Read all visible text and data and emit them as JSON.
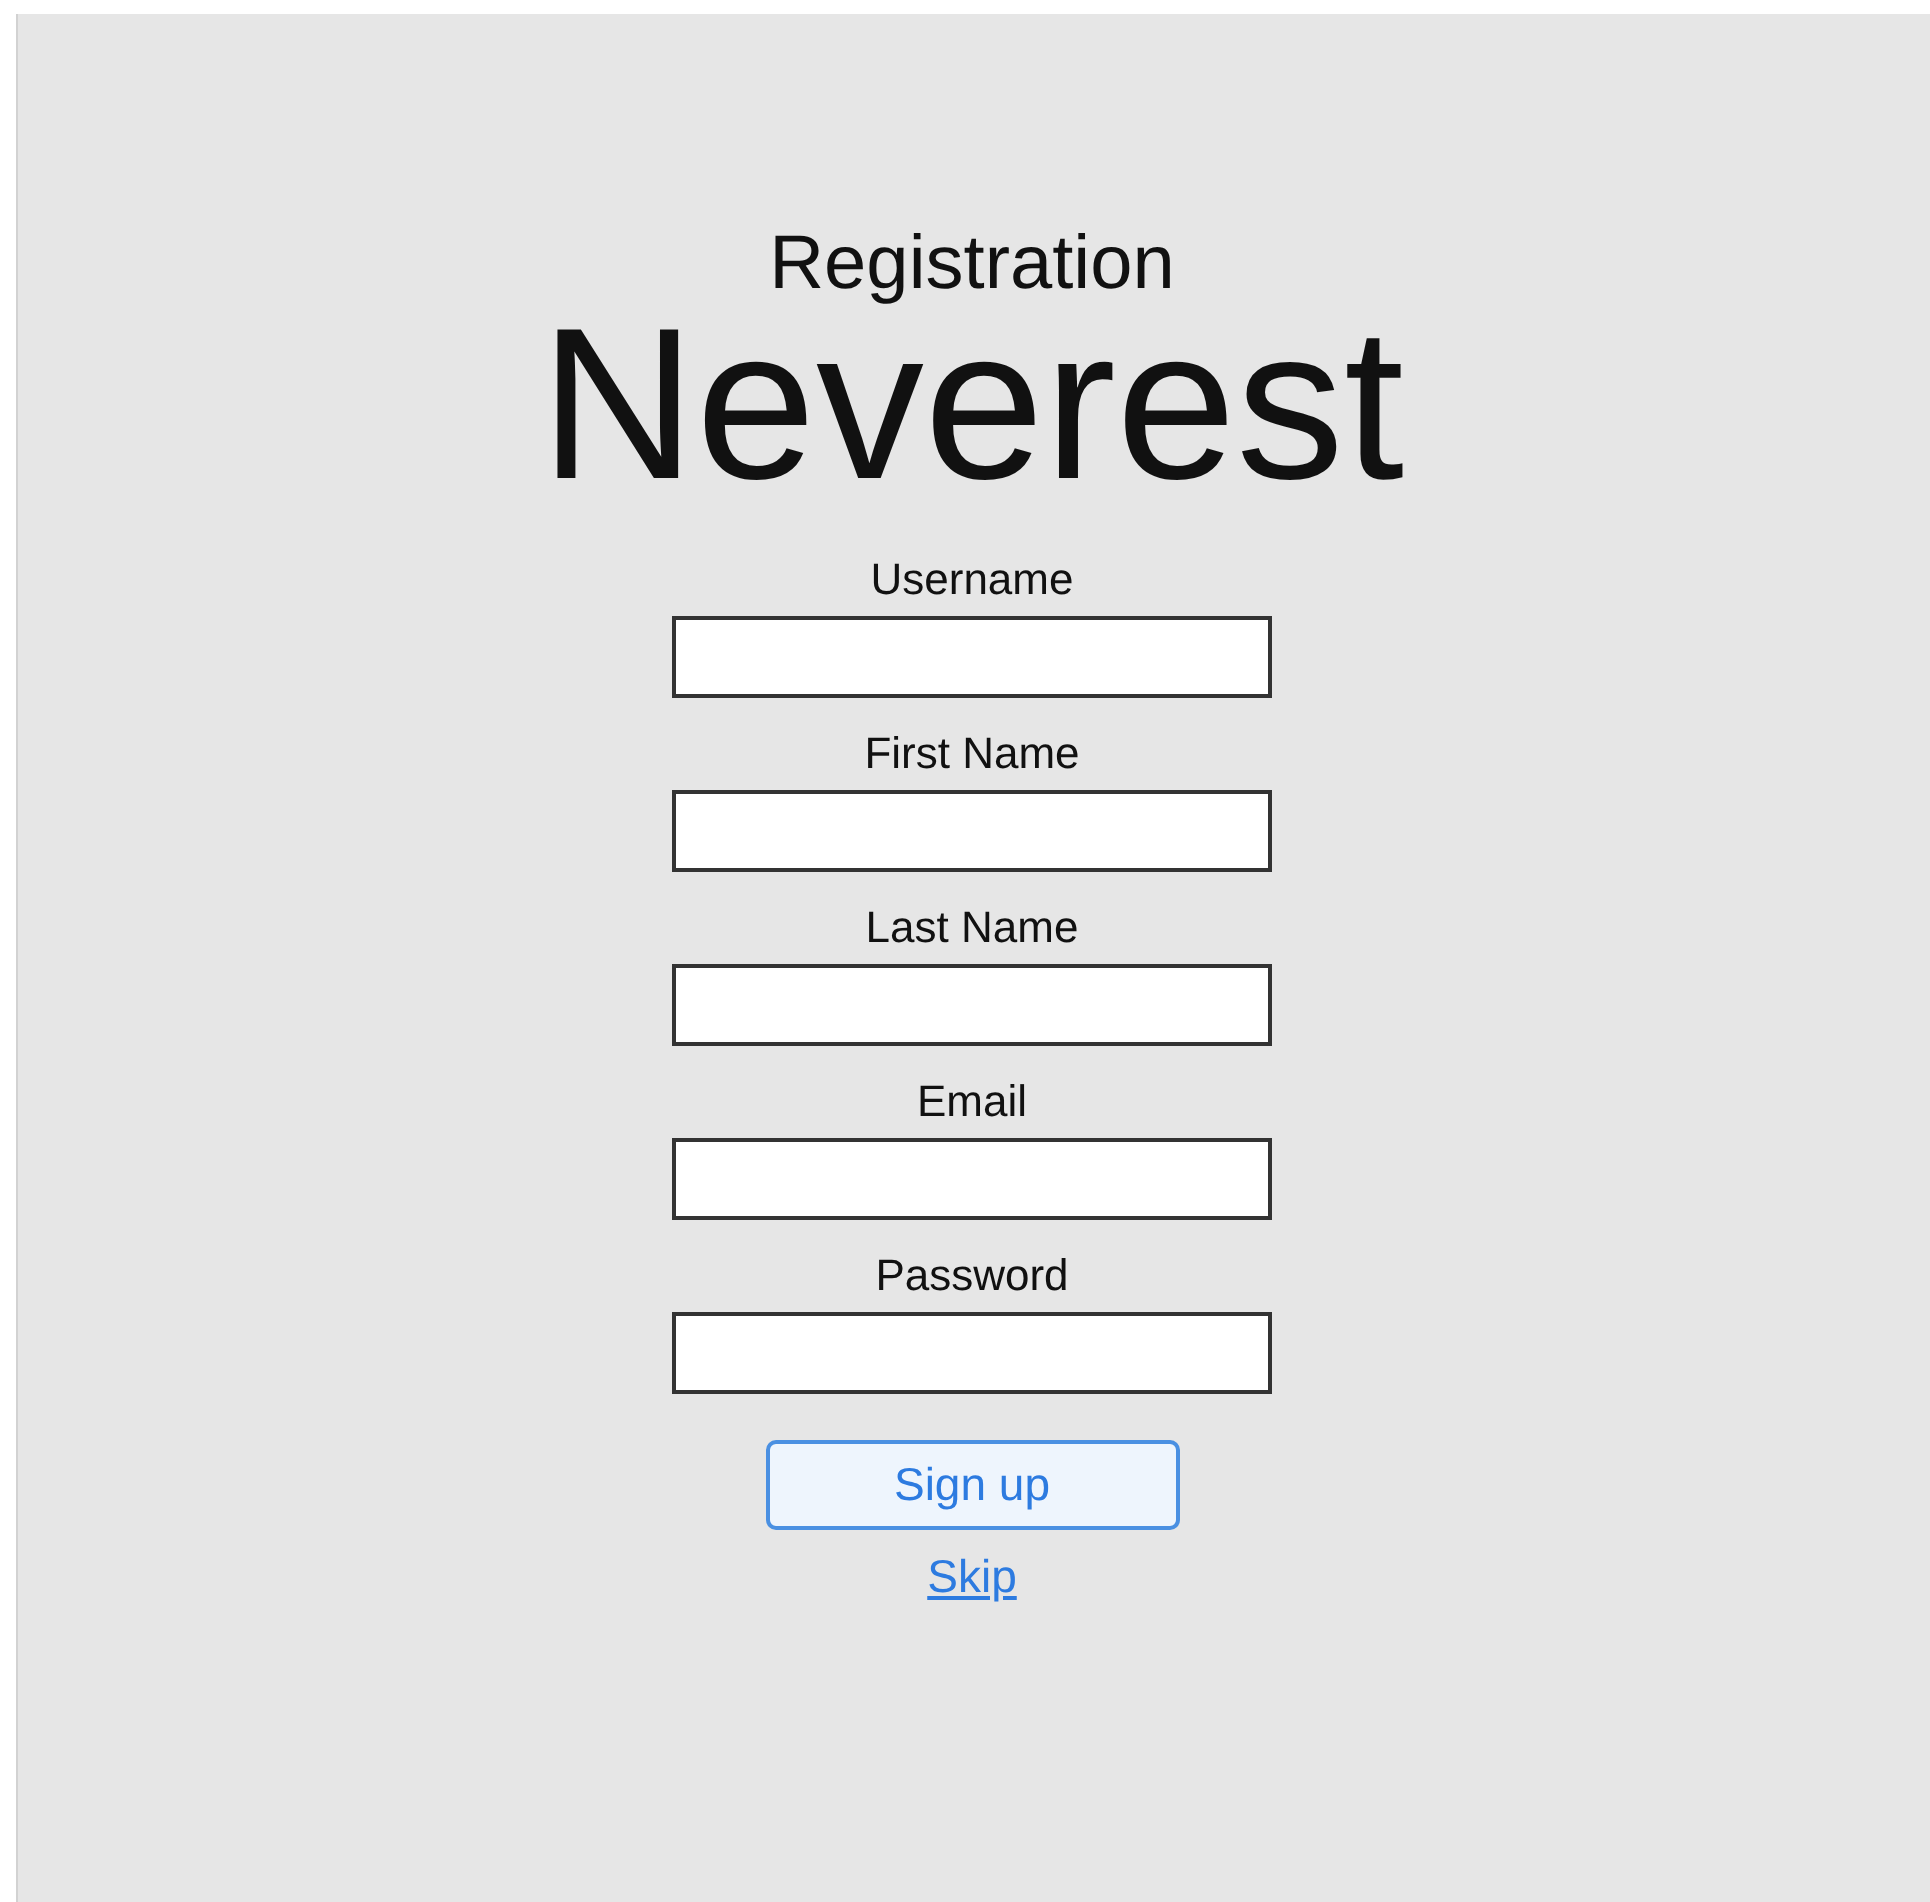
{
  "heading": "Registration",
  "brand": "Neverest",
  "fields": [
    {
      "label": "Username"
    },
    {
      "label": "First Name"
    },
    {
      "label": "Last Name"
    },
    {
      "label": "Email"
    },
    {
      "label": "Password"
    }
  ],
  "submit_button": "Sign up",
  "skip_link": "Skip"
}
